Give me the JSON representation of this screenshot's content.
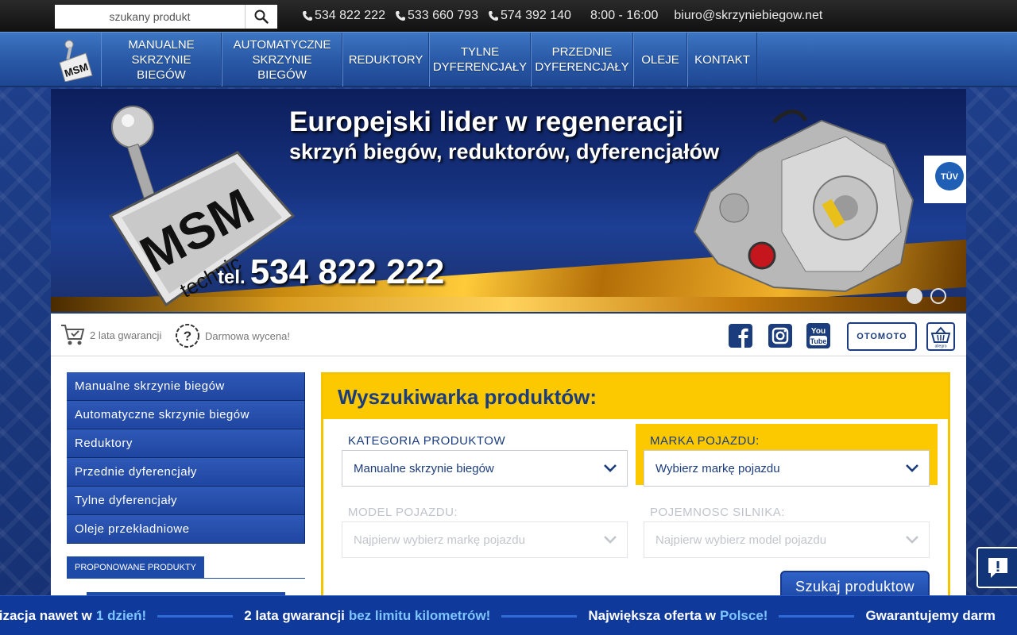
{
  "search": {
    "placeholder": "szukany produkt"
  },
  "contact": {
    "phones": [
      "534 822 222",
      "533 660 793",
      "574 392 140"
    ],
    "hours": "8:00 - 16:00",
    "email": "biuro@skrzyniebiegow.net"
  },
  "nav": {
    "logo_text": "MSM",
    "items": [
      {
        "label": "MANUALNE\nSKRZYNIE BIEGÓW"
      },
      {
        "label": "AUTOMATYCZNE\nSKRZYNIE BIEGÓW"
      },
      {
        "label": "REDUKTORY"
      },
      {
        "label": "TYLNE\nDYFERENCJAŁY"
      },
      {
        "label": "PRZEDNIE\nDYFERENCJAŁY"
      },
      {
        "label": "OLEJE"
      },
      {
        "label": "KONTAKT"
      }
    ]
  },
  "banner": {
    "title": "Europejski lider w regeneracji",
    "subtitle": "skrzyń biegów, reduktorów, dyferencjałów",
    "phone_prefix": "tel.",
    "phone": "534 822 222",
    "logo_text": "MSM",
    "logo_sub": "technic",
    "badge": "TÜV"
  },
  "infobar": {
    "guarantee": "2 lata gwarancji",
    "valuation": "Darmowa wycena!",
    "otomoto": "OTOMOTO",
    "allegro": "allegro"
  },
  "side_menu": {
    "items": [
      "Manualne skrzynie biegów",
      "Automatyczne skrzynie biegów",
      "Reduktory",
      "Przednie dyferencjały",
      "Tylne dyferencjały",
      "Oleje przekładniowe"
    ],
    "proposed_label": "PROPONOWANE PRODUKTY"
  },
  "finder": {
    "title": "Wyszukiwarka produktów:",
    "category_label": "KATEGORIA PRODUKTOW",
    "category_value": "Manualne skrzynie biegów",
    "brand_label": "MARKA POJAZDU:",
    "brand_value": "Wybierz markę pojazdu",
    "model_label": "MODEL POJAZDU:",
    "model_value": "Najpierw wybierz markę pojazdu",
    "engine_label": "POJEMNOSC SILNIKA:",
    "engine_value": "Najpierw wybierz model pojazdu",
    "button": "Szukaj produktow"
  },
  "ticker": [
    {
      "text": "lizacja nawet w",
      "highlight": "1 dzień!"
    },
    {
      "text": "2 lata gwarancji",
      "highlight": "bez limitu kilometrów!"
    },
    {
      "text": "Największa oferta w",
      "highlight": "Polsce!"
    },
    {
      "text": "Gwarantujemy darm",
      "highlight": ""
    }
  ],
  "colors": {
    "brand_blue": "#1c3d7d",
    "accent_yellow": "#fcc800",
    "menu_blue": "#1f46a0"
  }
}
